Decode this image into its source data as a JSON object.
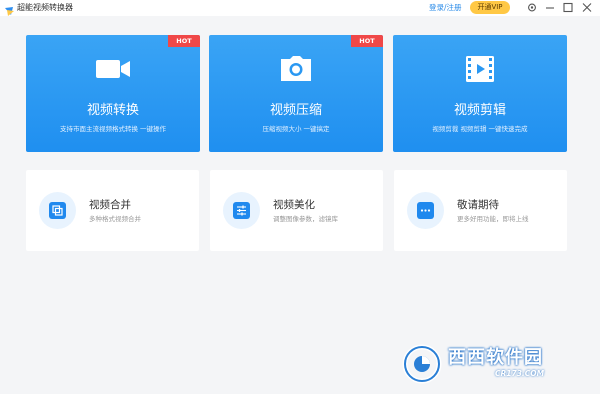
{
  "titlebar": {
    "title": "超能视频转换器",
    "login_label": "登录/注册",
    "vip_label": "开通VIP",
    "controls": [
      "gear-icon",
      "minimize-icon",
      "maximize-icon",
      "close-icon"
    ]
  },
  "big_cards": [
    {
      "title": "视频转换",
      "subtitle": "支持市面主流视频格式转换 一键操作",
      "badge": "HOT",
      "icon": "video-camera-icon"
    },
    {
      "title": "视频压缩",
      "subtitle": "压缩视频大小 一键搞定",
      "badge": "HOT",
      "icon": "photo-camera-icon"
    },
    {
      "title": "视频剪辑",
      "subtitle": "视频剪裁 视频剪辑 一键快速完成",
      "badge": "",
      "icon": "film-play-icon"
    }
  ],
  "small_cards": [
    {
      "title": "视频合并",
      "subtitle": "多种格式视频合并",
      "icon": "merge-icon"
    },
    {
      "title": "视频美化",
      "subtitle": "调整图像参数，滤镜库",
      "icon": "sliders-icon"
    },
    {
      "title": "敬请期待",
      "subtitle": "更多好用功能，即将上线",
      "icon": "more-dots-icon"
    }
  ],
  "watermark": {
    "brand": "西西软件园",
    "url": "CR173.COM"
  },
  "colors": {
    "accent": "#2089ee",
    "hot_badge": "#f04848",
    "vip": "#ffc845",
    "background": "#f4f5f7"
  }
}
